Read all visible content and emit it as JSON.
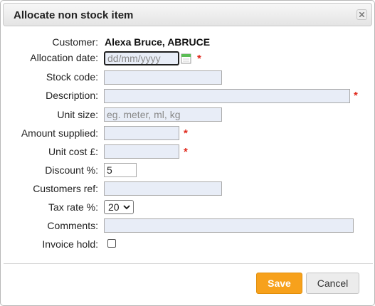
{
  "dialog": {
    "title": "Allocate non stock item",
    "close_icon": "close-icon"
  },
  "form": {
    "customer_label": "Customer:",
    "customer_value": "Alexa Bruce, ABRUCE",
    "allocation_date_label": "Allocation date:",
    "allocation_date_placeholder": "dd/mm/yyyy",
    "allocation_date_value": "",
    "stock_code_label": "Stock code:",
    "stock_code_value": "",
    "description_label": "Description:",
    "description_value": "",
    "unit_size_label": "Unit size:",
    "unit_size_placeholder": "eg. meter, ml, kg",
    "unit_size_value": "",
    "amount_supplied_label": "Amount supplied:",
    "amount_supplied_value": "",
    "unit_cost_label": "Unit cost £:",
    "unit_cost_value": "",
    "discount_label": "Discount %:",
    "discount_value": "5",
    "customers_ref_label": "Customers ref:",
    "customers_ref_value": "",
    "tax_rate_label": "Tax rate %:",
    "tax_rate_selected": "20",
    "comments_label": "Comments:",
    "comments_value": "",
    "invoice_hold_label": "Invoice hold:",
    "invoice_hold_checked": false,
    "required_marker": "*"
  },
  "buttons": {
    "save_label": "Save",
    "cancel_label": "Cancel"
  },
  "colors": {
    "accent": "#f7a11c",
    "required": "#e0281b",
    "input_bg": "#e8edf7"
  }
}
